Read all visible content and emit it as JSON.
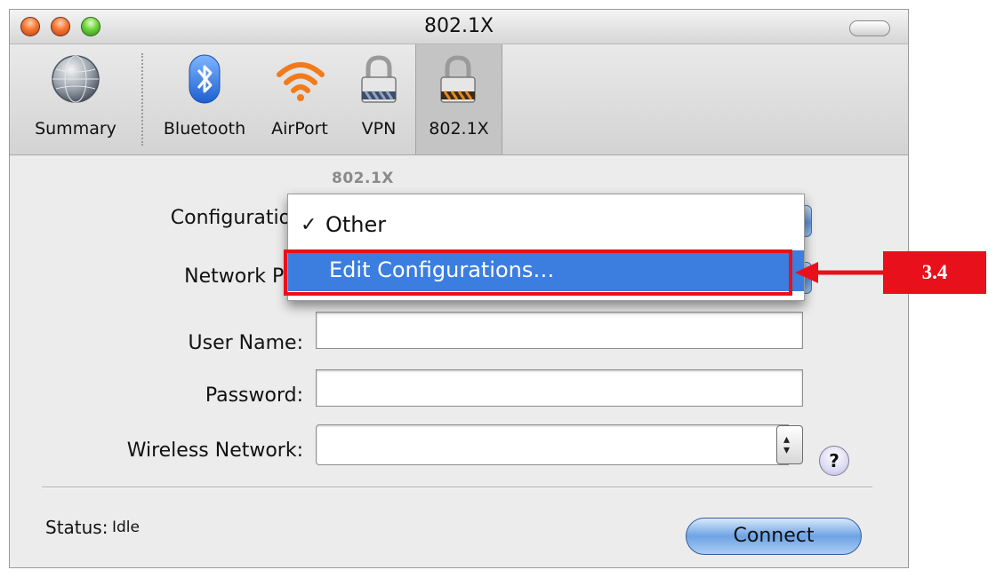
{
  "window": {
    "title": "802.1X"
  },
  "toolbar": {
    "items": [
      {
        "label": "Summary",
        "icon": "globe-icon"
      },
      {
        "label": "Bluetooth",
        "icon": "bluetooth-icon"
      },
      {
        "label": "AirPort",
        "icon": "wifi-icon"
      },
      {
        "label": "VPN",
        "icon": "lock-icon"
      },
      {
        "label": "802.1X",
        "icon": "lock-icon",
        "selected": true
      }
    ]
  },
  "form": {
    "section_label": "802.1X",
    "configuration_label": "Configuration",
    "network_port_label": "Network Por",
    "username_label": "User Name:",
    "username_value": "",
    "password_label": "Password:",
    "password_value": "",
    "wireless_label": "Wireless Network:",
    "wireless_value": "",
    "help_label": "?"
  },
  "menu": {
    "check_mark": "✓",
    "items": [
      {
        "label": "Other",
        "checked": true
      },
      {
        "label": "Edit Configurations…",
        "highlighted": true
      }
    ]
  },
  "status": {
    "label": "Status:",
    "value": "Idle"
  },
  "actions": {
    "connect_label": "Connect"
  },
  "annotation": {
    "label": "3.4",
    "color": "#e8111b"
  },
  "colors": {
    "menu_highlight": "#3c7de0",
    "aqua_blue": "#6ea3e4"
  }
}
